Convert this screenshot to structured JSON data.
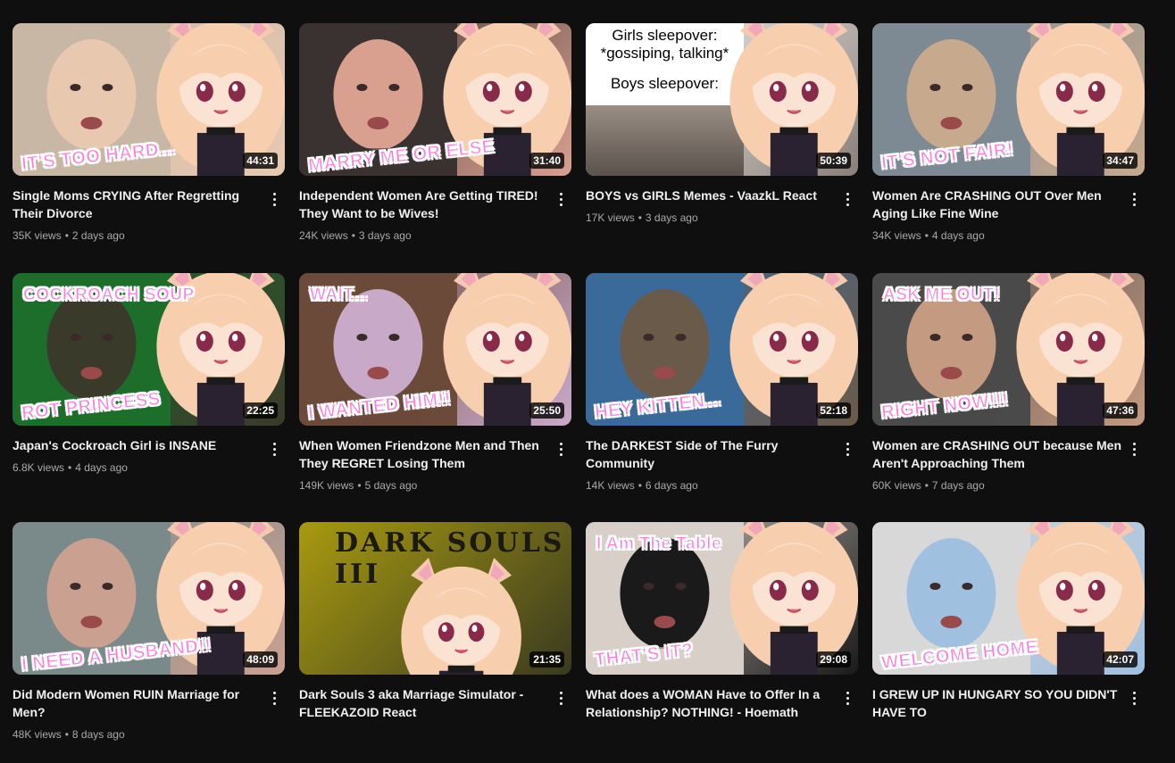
{
  "videos": [
    {
      "title": "Single Moms CRYING After Regretting Their Divorce",
      "views": "35K views",
      "age": "2 days ago",
      "duration": "44:31",
      "caption": "IT'S TOO HARD...",
      "colors": [
        "#c9b7a6",
        "#e8c9b0"
      ]
    },
    {
      "title": "Independent Women Are Getting TIRED! They Want to be Wives!",
      "views": "24K views",
      "age": "3 days ago",
      "duration": "31:40",
      "caption": "MARRY ME OR ELSE",
      "colors": [
        "#3a3230",
        "#d9a090"
      ]
    },
    {
      "title": "BOYS vs GIRLS Memes - VaazkL React",
      "views": "17K views",
      "age": "3 days ago",
      "duration": "50:39",
      "caption": "",
      "colors": [
        "#ffffff",
        "#8a7f78"
      ],
      "meme": [
        "Girls sleepover:",
        "*gossiping, talking*",
        "Boys sleepover:"
      ]
    },
    {
      "title": "Women Are CRASHING OUT Over Men Aging Like Fine Wine",
      "views": "34K views",
      "age": "4 days ago",
      "duration": "34:47",
      "caption": "IT'S NOT FAIR!",
      "colors": [
        "#7d8a94",
        "#c7a98e"
      ]
    },
    {
      "title": "Japan's Cockroach Girl is INSANE",
      "views": "6.8K views",
      "age": "4 days ago",
      "duration": "22:25",
      "caption": "ROT PRINCESS",
      "caption2": "COCKROACH SOUP",
      "colors": [
        "#1d6e2a",
        "#3a3a2a"
      ]
    },
    {
      "title": "When Women Friendzone Men and Then They REGRET Losing Them",
      "views": "149K views",
      "age": "5 days ago",
      "duration": "25:50",
      "caption": "I WANTED HIM!!",
      "caption2": "WAIT...",
      "colors": [
        "#6b4a3a",
        "#c9a9c8"
      ]
    },
    {
      "title": "The DARKEST Side of The Furry Community",
      "views": "14K views",
      "age": "6 days ago",
      "duration": "52:18",
      "caption": "HEY KITTEN...",
      "colors": [
        "#3a6a9a",
        "#6a5a4a"
      ]
    },
    {
      "title": "Women are CRASHING OUT because Men Aren't Approaching Them",
      "views": "60K views",
      "age": "7 days ago",
      "duration": "47:36",
      "caption": "RIGHT NOW!!!",
      "caption2": "ASK ME OUT!",
      "colors": [
        "#4a4a4a",
        "#c49a80"
      ]
    },
    {
      "title": "Did Modern Women RUIN Marriage for Men?",
      "views": "48K views",
      "age": "8 days ago",
      "duration": "48:09",
      "caption": "I NEED A HUSBAND!!",
      "colors": [
        "#7a8a8a",
        "#caa090"
      ]
    },
    {
      "title": "Dark Souls 3 aka Marriage Simulator - FLEEKAZOID React",
      "views": "",
      "age": "",
      "duration": "21:35",
      "caption": "",
      "colors": [
        "#a89a10",
        "#3a3a20"
      ],
      "banner": "DARK SOULS III"
    },
    {
      "title": "What does a WOMAN Have to Offer In a Relationship? NOTHING! - Hoemath React",
      "views": "",
      "age": "",
      "duration": "29:08",
      "caption": "THAT'S IT?",
      "caption2": "I Am The Table",
      "colors": [
        "#d8d0c8",
        "#1a1a1a"
      ]
    },
    {
      "title": "I GREW UP IN HUNGARY SO YOU DIDN'T HAVE TO",
      "views": "",
      "age": "",
      "duration": "42:07",
      "caption": "WELCOME HOME",
      "colors": [
        "#d8d8d8",
        "#a0c0e0"
      ]
    }
  ]
}
